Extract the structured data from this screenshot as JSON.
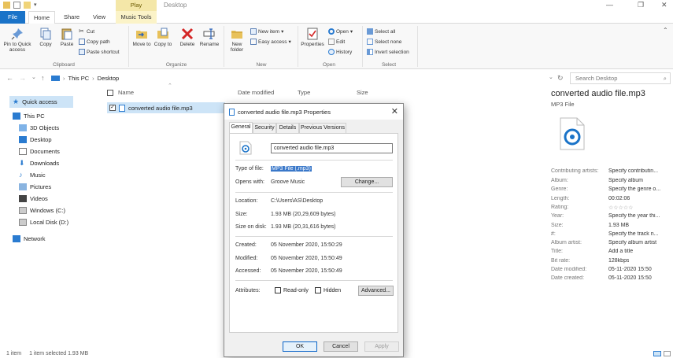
{
  "window": {
    "title": "Desktop",
    "context_tab_group": "Play"
  },
  "ribbon_tabs": [
    {
      "label": "File"
    },
    {
      "label": "Home"
    },
    {
      "label": "Share"
    },
    {
      "label": "View"
    },
    {
      "label": "Music Tools"
    }
  ],
  "ribbon": {
    "pin_label": "Pin to Quick access",
    "copy_label": "Copy",
    "paste_label": "Paste",
    "cut_label": "Cut",
    "copy_path_label": "Copy path",
    "paste_shortcut_label": "Paste shortcut",
    "clipboard_group": "Clipboard",
    "move_to_label": "Move to",
    "copy_to_label": "Copy to",
    "delete_label": "Delete",
    "rename_label": "Rename",
    "organize_group": "Organize",
    "new_folder_label": "New folder",
    "new_item_label": "New item",
    "easy_access_label": "Easy access",
    "new_group": "New",
    "properties_label": "Properties",
    "open_label": "Open",
    "edit_label": "Edit",
    "history_label": "History",
    "open_group": "Open",
    "select_all_label": "Select all",
    "select_none_label": "Select none",
    "invert_selection_label": "Invert selection",
    "select_group": "Select"
  },
  "address": {
    "crumb1": "This PC",
    "crumb2": "Desktop",
    "search_placeholder": "Search Desktop"
  },
  "nav": {
    "quick_access": "Quick access",
    "this_pc": "This PC",
    "items": [
      "3D Objects",
      "Desktop",
      "Documents",
      "Downloads",
      "Music",
      "Pictures",
      "Videos",
      "Windows (C:)",
      "Local Disk (D:)"
    ],
    "network": "Network"
  },
  "columns": {
    "name": "Name",
    "date": "Date modified",
    "type": "Type",
    "size": "Size"
  },
  "file": {
    "name": "converted audio file.mp3"
  },
  "details": {
    "title": "converted audio file.mp3",
    "subtitle": "MP3 File",
    "rows": [
      {
        "k": "Contributing artists:",
        "v": "Specify contributin..."
      },
      {
        "k": "Album:",
        "v": "Specify album"
      },
      {
        "k": "Genre:",
        "v": "Specify the genre o..."
      },
      {
        "k": "Length:",
        "v": "00:02:06"
      },
      {
        "k": "Rating:",
        "v": "☆☆☆☆☆"
      },
      {
        "k": "Year:",
        "v": "Specify the year thi..."
      },
      {
        "k": "Size:",
        "v": "1.93 MB"
      },
      {
        "k": "#:",
        "v": "Specify the track n..."
      },
      {
        "k": "Album artist:",
        "v": "Specify album artist"
      },
      {
        "k": "Title:",
        "v": "Add a title"
      },
      {
        "k": "Bit rate:",
        "v": "128kbps"
      },
      {
        "k": "Date modified:",
        "v": "05-11-2020 15:50"
      },
      {
        "k": "Date created:",
        "v": "05-11-2020 15:50"
      }
    ]
  },
  "status": {
    "items": "1 item",
    "selected": "1 item selected  1.93 MB"
  },
  "dialog": {
    "title": "converted audio file.mp3 Properties",
    "tabs": [
      "General",
      "Security",
      "Details",
      "Previous Versions"
    ],
    "filename": "converted audio file.mp3",
    "type_label": "Type of file:",
    "type_value": "MP3 File (.mp3)",
    "opens_label": "Opens with:",
    "opens_value": "Groove Music",
    "change_button": "Change...",
    "location_label": "Location:",
    "location_value": "C:\\Users\\AS\\Desktop",
    "size_label": "Size:",
    "size_value": "1.93 MB (20,29,609 bytes)",
    "disk_label": "Size on disk:",
    "disk_value": "1.93 MB (20,31,616 bytes)",
    "created_label": "Created:",
    "created_value": "05 November 2020, 15:50:29",
    "modified_label": "Modified:",
    "modified_value": "05 November 2020, 15:50:49",
    "accessed_label": "Accessed:",
    "accessed_value": "05 November 2020, 15:50:49",
    "attributes_label": "Attributes:",
    "readonly_label": "Read-only",
    "hidden_label": "Hidden",
    "advanced_button": "Advanced...",
    "ok_button": "OK",
    "cancel_button": "Cancel",
    "apply_button": "Apply"
  },
  "colors": {
    "accent": "#1a73c8",
    "selection": "#cde4f7",
    "context_tab": "#f4e7a8"
  }
}
